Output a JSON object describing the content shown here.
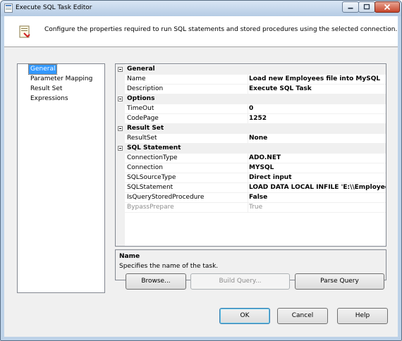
{
  "window": {
    "title": "Execute SQL Task Editor"
  },
  "header": {
    "description": "Configure the properties required to run SQL statements and stored procedures using the selected connection."
  },
  "nav": {
    "items": [
      {
        "label": "General"
      },
      {
        "label": "Parameter Mapping"
      },
      {
        "label": "Result Set"
      },
      {
        "label": "Expressions"
      }
    ]
  },
  "grid": {
    "rows": [
      {
        "label": "General"
      },
      {
        "name": "Name",
        "value": "Load new Employees file into MySQL"
      },
      {
        "name": "Description",
        "value": "Execute SQL Task"
      },
      {
        "label": "Options"
      },
      {
        "name": "TimeOut",
        "value": "0"
      },
      {
        "name": "CodePage",
        "value": "1252"
      },
      {
        "label": "Result Set"
      },
      {
        "name": "ResultSet",
        "value": "None"
      },
      {
        "label": "SQL Statement"
      },
      {
        "name": "ConnectionType",
        "value": "ADO.NET"
      },
      {
        "name": "Connection",
        "value": "MYSQL"
      },
      {
        "name": "SQLSourceType",
        "value": "Direct input"
      },
      {
        "name": "SQLStatement",
        "value": "LOAD DATA LOCAL INFILE 'E:\\\\Employees.txt' i"
      },
      {
        "name": "IsQueryStoredProcedure",
        "value": "False"
      },
      {
        "name": "BypassPrepare",
        "value": "True"
      }
    ]
  },
  "description_panel": {
    "title": "Name",
    "text": "Specifies the name of the task."
  },
  "buttons": {
    "browse": "Browse...",
    "build_query": "Build Query...",
    "parse_query": "Parse Query",
    "ok": "OK",
    "cancel": "Cancel",
    "help": "Help"
  }
}
